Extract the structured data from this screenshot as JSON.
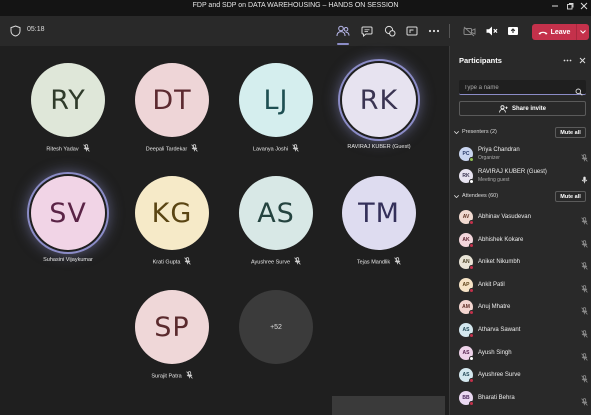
{
  "window": {
    "title": "FDP and SDP on DATA WAREHOUSING – HANDS ON SESSION",
    "controls": [
      "minimize-icon",
      "maximize-icon",
      "close-icon"
    ]
  },
  "toolbar": {
    "timer": "05:18",
    "leave_label": "Leave",
    "accent_color": "#8b8cc7",
    "leave_color": "#c4314b"
  },
  "tiles": [
    {
      "initials": "RY",
      "name": "Ritesh Yadav",
      "bg": "#dfe7d9",
      "fg": "#2f3b2a",
      "muted": true,
      "speaking": false
    },
    {
      "initials": "DT",
      "name": "Deepali Tardekar",
      "bg": "#eed5d7",
      "fg": "#5c2a30",
      "muted": true,
      "speaking": false
    },
    {
      "initials": "LJ",
      "name": "Lavanya Joshi",
      "bg": "#d5eeee",
      "fg": "#1e4f52",
      "muted": true,
      "speaking": false
    },
    {
      "initials": "RK",
      "name": "RAVIRAJ KUBER (Guest)",
      "bg": "#e7e3f0",
      "fg": "#3a3452",
      "muted": false,
      "speaking": true
    },
    {
      "initials": "SV",
      "name": "Suhasini Vijaykumar",
      "bg": "#f1d4e6",
      "fg": "#5a2346",
      "muted": false,
      "speaking": true
    },
    {
      "initials": "KG",
      "name": "Krati Gupta",
      "bg": "#f6eac8",
      "fg": "#5a4513",
      "muted": true,
      "speaking": false
    },
    {
      "initials": "AS",
      "name": "Ayushree Surve",
      "bg": "#d8e8e6",
      "fg": "#24433f",
      "muted": true,
      "speaking": false
    },
    {
      "initials": "TM",
      "name": "Tejas Mandlik",
      "bg": "#dedcf0",
      "fg": "#34305a",
      "muted": true,
      "speaking": false
    },
    {
      "initials": "SP",
      "name": "Surajit Patra",
      "bg": "#efd7d8",
      "fg": "#5a2a2d",
      "muted": true,
      "speaking": false
    }
  ],
  "overflow_count": "+52",
  "panel": {
    "title": "Participants",
    "search_placeholder": "Type a name",
    "share_invite": "Share invite",
    "presenters_label": "Presenters (2)",
    "attendees_label": "Attendees (60)",
    "mute_all": "Mute all",
    "presenters": [
      {
        "initials": "PC",
        "name": "Priya Chandran",
        "role": "Organizer",
        "avatar_bg": "#c9d5f0",
        "avatar_fg": "#2b3d6b",
        "status": "#92c353",
        "muted": true
      },
      {
        "initials": "RK",
        "name": "RAVIRAJ KUBER (Guest)",
        "role": "Meeting guest",
        "avatar_bg": "#e7e3f0",
        "avatar_fg": "#3a3452",
        "status": "#ffffff",
        "muted": false
      }
    ],
    "attendees": [
      {
        "initials": "AV",
        "name": "Abhinav Vasudevan",
        "avatar_bg": "#f0d9d0",
        "avatar_fg": "#5c3020",
        "status": "#c4314b",
        "muted": true
      },
      {
        "initials": "AK",
        "name": "Abhishek Kokare",
        "avatar_bg": "#f3d6dc",
        "avatar_fg": "#5c2330",
        "status": "#c4314b",
        "muted": true
      },
      {
        "initials": "AN",
        "name": "Aniket Nikumbh",
        "avatar_bg": "#e9e4d6",
        "avatar_fg": "#4b4226",
        "status": "#c4314b",
        "muted": true
      },
      {
        "initials": "AP",
        "name": "Ankit Patil",
        "avatar_bg": "#f6e3c6",
        "avatar_fg": "#5c4016",
        "status": "#c4314b",
        "muted": true
      },
      {
        "initials": "AM",
        "name": "Anuj Mhatre",
        "avatar_bg": "#f3d5d0",
        "avatar_fg": "#5c2a22",
        "status": "#c4314b",
        "muted": true
      },
      {
        "initials": "AS",
        "name": "Atharva Sawant",
        "avatar_bg": "#d4e8ef",
        "avatar_fg": "#1f4654",
        "status": "#c4314b",
        "muted": true
      },
      {
        "initials": "AS",
        "name": "Ayush Singh",
        "avatar_bg": "#efd3ea",
        "avatar_fg": "#55224e",
        "status": "#ffffff",
        "muted": true
      },
      {
        "initials": "AS",
        "name": "Ayushree Surve",
        "avatar_bg": "#d4e8ef",
        "avatar_fg": "#1f4654",
        "status": "#c4314b",
        "muted": true
      },
      {
        "initials": "BB",
        "name": "Bharati Behra",
        "avatar_bg": "#ead8f2",
        "avatar_fg": "#48255a",
        "status": "#c4314b",
        "muted": true
      }
    ]
  }
}
